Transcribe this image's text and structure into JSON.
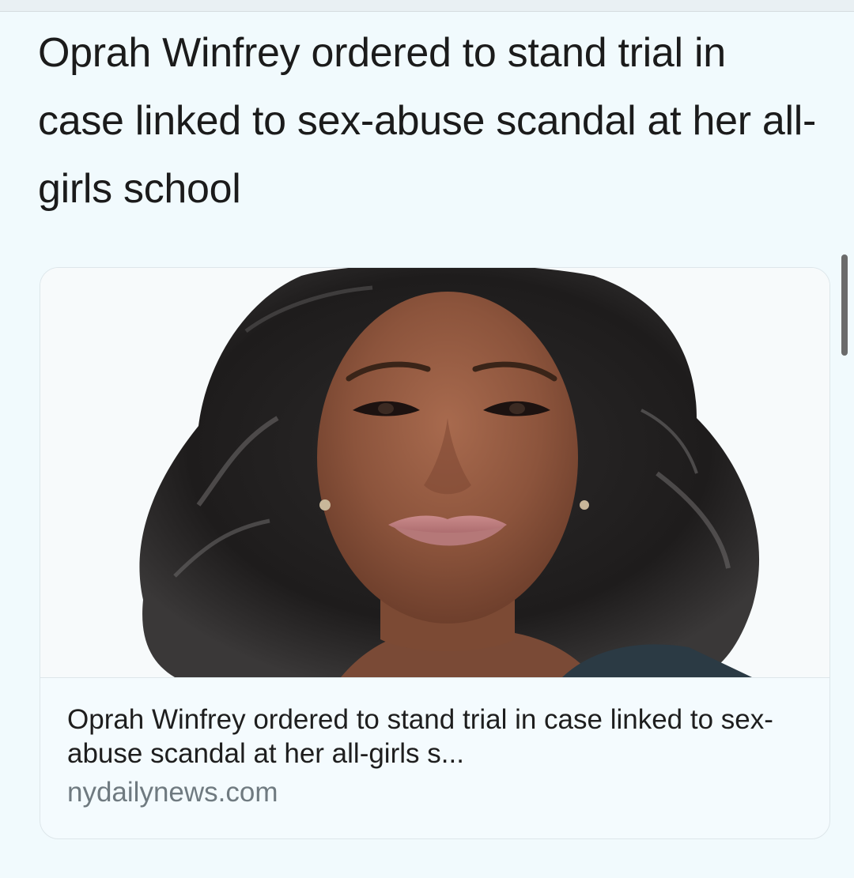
{
  "headline": "Oprah Winfrey ordered to stand trial in case linked to sex-abuse scandal at her all-girls school",
  "link_card": {
    "image_icon": "portrait-photo-icon",
    "title": "Oprah Winfrey ordered to stand trial in case linked to sex-abuse scandal at her all-girls s...",
    "domain": "nydailynews.com"
  },
  "colors": {
    "background": "#f1fafd",
    "headline_text": "#1b1b1b",
    "domain_text": "#6f7a80",
    "card_border": "#dde6ea"
  }
}
